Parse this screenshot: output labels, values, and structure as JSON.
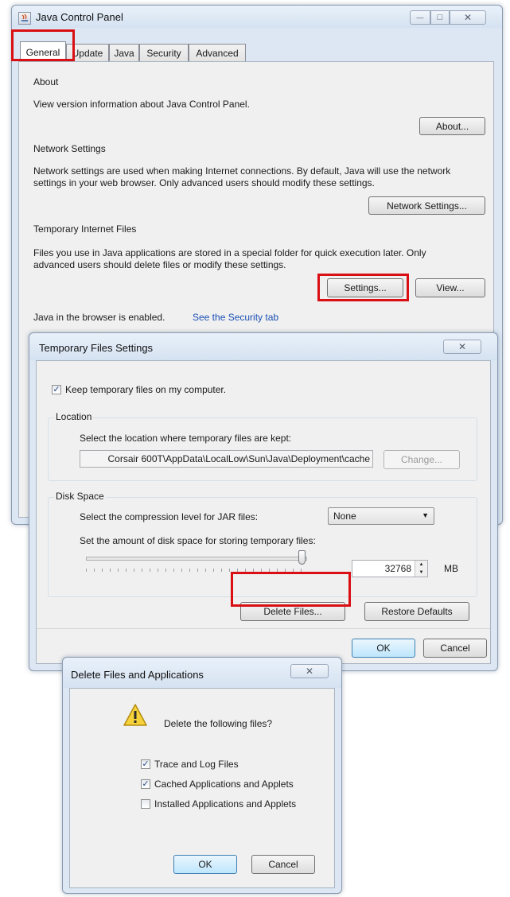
{
  "control_panel": {
    "title": "Java Control Panel",
    "tabs": [
      "General",
      "Update",
      "Java",
      "Security",
      "Advanced"
    ],
    "about": {
      "heading": "About",
      "description": "View version information about Java Control Panel.",
      "button": "About..."
    },
    "network": {
      "heading": "Network Settings",
      "description_line1": "Network settings are used when making Internet connections. By default, Java will use the network",
      "description_line2": "settings in your web browser. Only advanced users should modify these settings.",
      "button": "Network Settings..."
    },
    "temp_files": {
      "heading": "Temporary Internet Files",
      "description_line1": "Files you use in Java applications are stored in a special folder for quick execution later. Only",
      "description_line2": "advanced users should delete files or modify these settings.",
      "settings_button": "Settings...",
      "view_button": "View..."
    },
    "browser_status": "Java in the browser is enabled.",
    "security_link": "See the Security tab"
  },
  "temp_settings_dialog": {
    "title": "Temporary Files Settings",
    "keep_files_label": "Keep temporary files on my computer.",
    "keep_files_checked": true,
    "location": {
      "group_label": "Location",
      "prompt": "Select the location where temporary files are kept:",
      "path": "Corsair 600T\\AppData\\LocalLow\\Sun\\Java\\Deployment\\cache",
      "change_button": "Change..."
    },
    "disk_space": {
      "group_label": "Disk Space",
      "compression_label": "Select the compression level for JAR files:",
      "compression_value": "None",
      "amount_label": "Set the amount of disk space for storing temporary files:",
      "amount_value": "32768",
      "unit": "MB",
      "slider_level": 0.99
    },
    "delete_button": "Delete Files...",
    "restore_button": "Restore Defaults",
    "ok_button": "OK",
    "cancel_button": "Cancel"
  },
  "delete_dialog": {
    "title": "Delete Files and Applications",
    "prompt": "Delete the following files?",
    "options": [
      {
        "label": "Trace and Log Files",
        "checked": true
      },
      {
        "label": "Cached Applications and Applets",
        "checked": true
      },
      {
        "label": "Installed Applications and Applets",
        "checked": false
      }
    ],
    "ok_button": "OK",
    "cancel_button": "Cancel"
  },
  "icons": {
    "close_glyph": "✕",
    "check_glyph": "✓",
    "minimize_glyph": "—",
    "maximize_glyph": "□",
    "dropdown_glyph": "▼",
    "warning_glyph": "!"
  },
  "colors": {
    "highlight_box": "#d90f14",
    "link": "#1a4fb5",
    "window_frame": "#dce7f3"
  }
}
